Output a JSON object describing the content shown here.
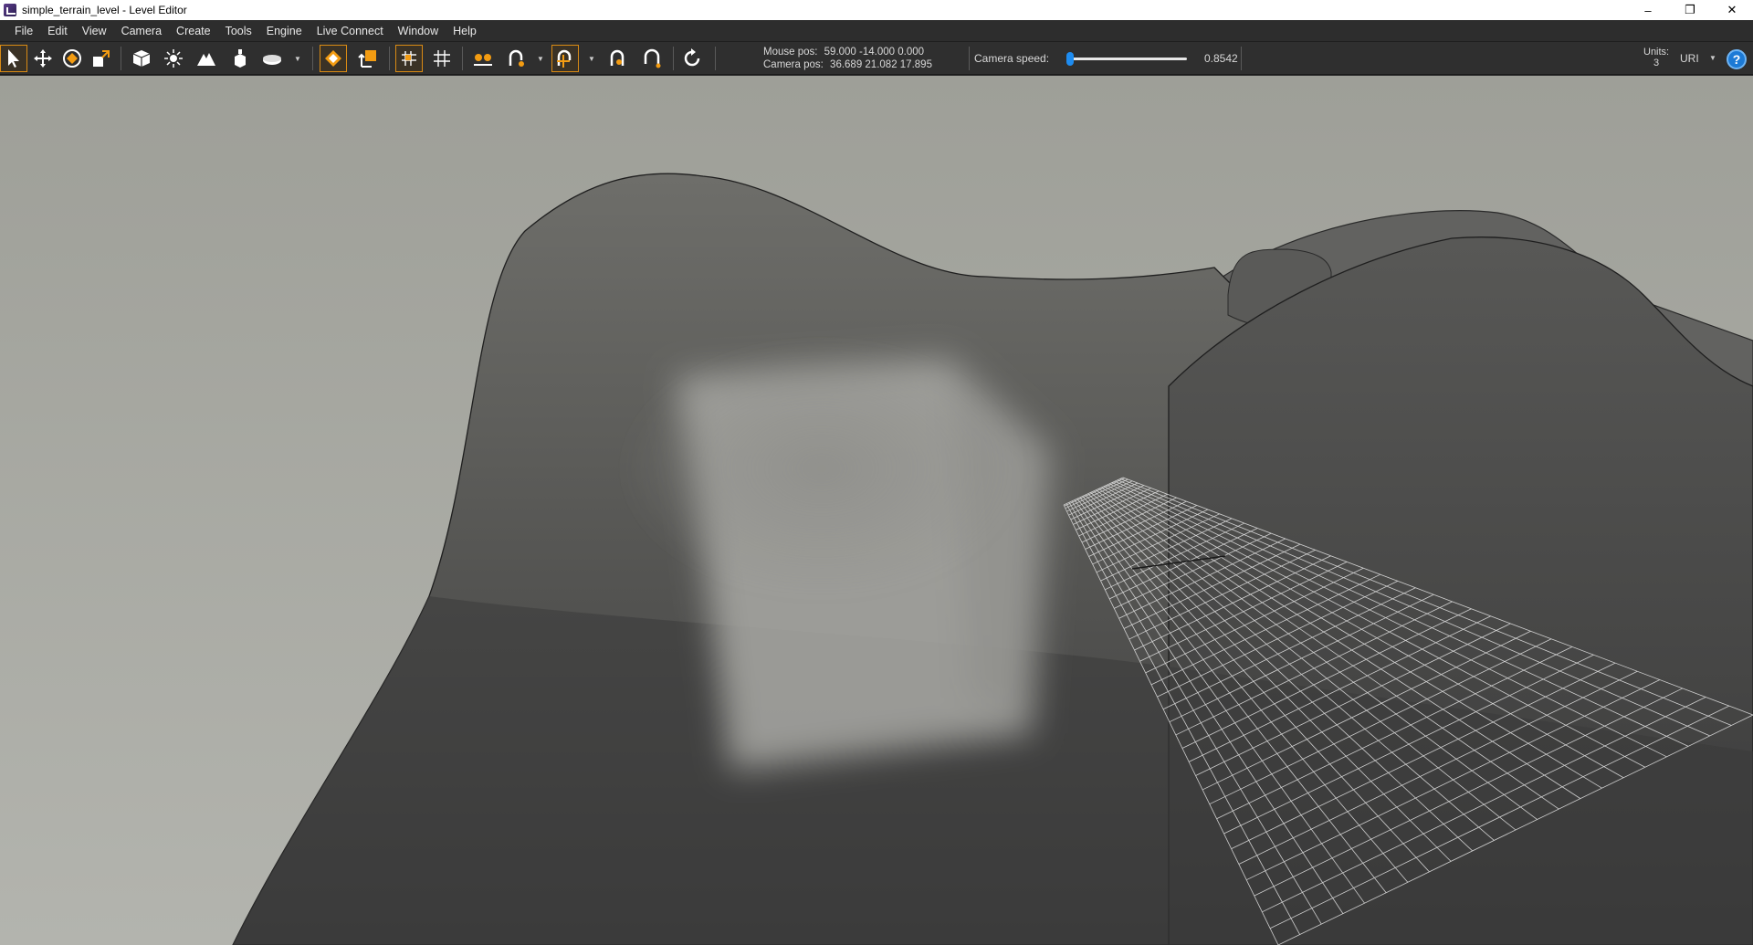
{
  "window": {
    "title": "simple_terrain_level - Level Editor",
    "controls": {
      "minimize": "–",
      "restore": "❐",
      "close": "✕"
    }
  },
  "menu": [
    "File",
    "Edit",
    "View",
    "Camera",
    "Create",
    "Tools",
    "Engine",
    "Live Connect",
    "Window",
    "Help"
  ],
  "toolbar": {
    "tools": [
      {
        "name": "select-tool",
        "icon": "arrow-cursor-icon",
        "active": true
      },
      {
        "name": "move-tool",
        "icon": "move-arrows-icon",
        "active": false
      },
      {
        "name": "rotate-tool",
        "icon": "rotate-diamond-icon",
        "active": false
      },
      {
        "name": "scale-tool",
        "icon": "scale-square-icon",
        "active": false
      },
      {
        "name": "create-box-tool",
        "icon": "cube-icon",
        "active": false
      },
      {
        "name": "light-tool",
        "icon": "light-bulb-icon",
        "active": false
      },
      {
        "name": "terrain-tool",
        "icon": "terrain-mountain-icon",
        "active": false
      },
      {
        "name": "prefab-tool",
        "icon": "prefab-icon",
        "active": false
      },
      {
        "name": "surface-tool",
        "icon": "surface-icon",
        "active": false
      }
    ],
    "readout": {
      "mouse_label": "Mouse pos:",
      "mouse_value": "59.000 -14.000 0.000",
      "camera_label": "Camera pos:",
      "camera_value": "36.689 21.082 17.895"
    },
    "camera_speed_label": "Camera speed:",
    "camera_speed_value": "0.8542",
    "camera_speed_fraction": 0.03,
    "units_label": "Units:",
    "units_value": "3",
    "units_select": "URI",
    "help": "?",
    "accent_color": "#d98a14",
    "slider_color": "#1e90ff"
  }
}
